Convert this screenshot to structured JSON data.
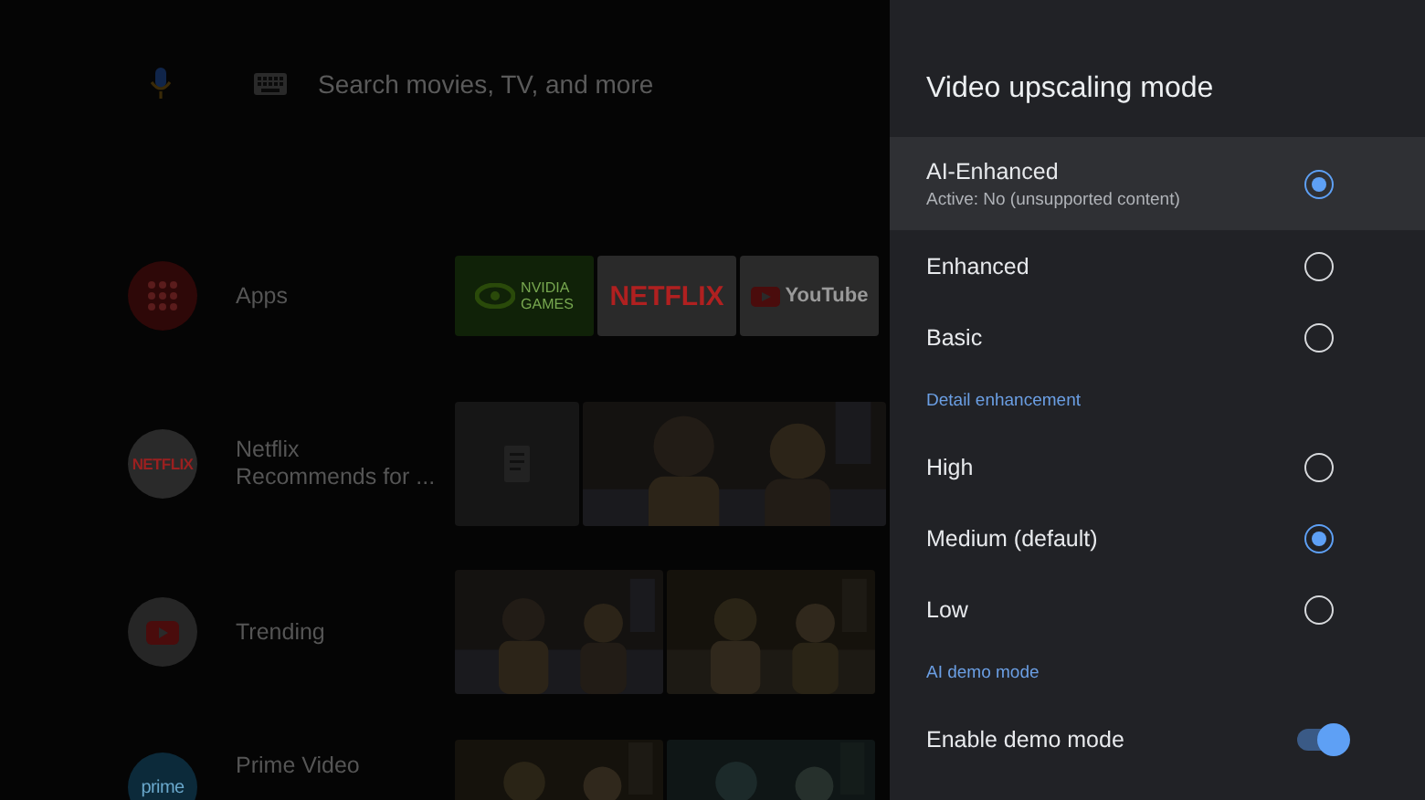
{
  "search": {
    "placeholder": "Search movies, TV, and more"
  },
  "rows": [
    {
      "kind": "apps",
      "label": "Apps",
      "tiles": [
        {
          "kind": "nvidia",
          "text": "NVIDIA",
          "subtext": "GAMES"
        },
        {
          "kind": "netflix",
          "text": "NETFLIX"
        },
        {
          "kind": "youtube",
          "text": "YouTube"
        }
      ]
    },
    {
      "kind": "netflix",
      "label": "Netflix\nRecommends for ...",
      "badge": "NETFLIX",
      "tiles": [
        {
          "kind": "doc"
        },
        {
          "kind": "picture"
        }
      ]
    },
    {
      "kind": "youtube",
      "label": "Trending",
      "tiles": [
        {
          "kind": "picture"
        },
        {
          "kind": "picture"
        }
      ]
    },
    {
      "kind": "prime",
      "label": "Prime Video",
      "badge": "prime",
      "tiles": [
        {
          "kind": "picture"
        },
        {
          "kind": "picture"
        }
      ]
    }
  ],
  "panel": {
    "title": "Video upscaling mode",
    "items": [
      {
        "kind": "radio",
        "label": "AI-Enhanced",
        "sublabel": "Active: No (unsupported content)",
        "selected": true,
        "focused": true
      },
      {
        "kind": "radio",
        "label": "Enhanced",
        "selected": false,
        "focused": false
      },
      {
        "kind": "radio",
        "label": "Basic",
        "selected": false,
        "focused": false
      },
      {
        "kind": "header",
        "label": "Detail enhancement"
      },
      {
        "kind": "radio",
        "label": "High",
        "selected": false,
        "focused": false
      },
      {
        "kind": "radio",
        "label": "Medium (default)",
        "selected": true,
        "focused": false
      },
      {
        "kind": "radio",
        "label": "Low",
        "selected": false,
        "focused": false
      },
      {
        "kind": "header",
        "label": "AI demo mode"
      },
      {
        "kind": "toggle",
        "label": "Enable demo mode",
        "on": true,
        "focused": false
      }
    ]
  }
}
